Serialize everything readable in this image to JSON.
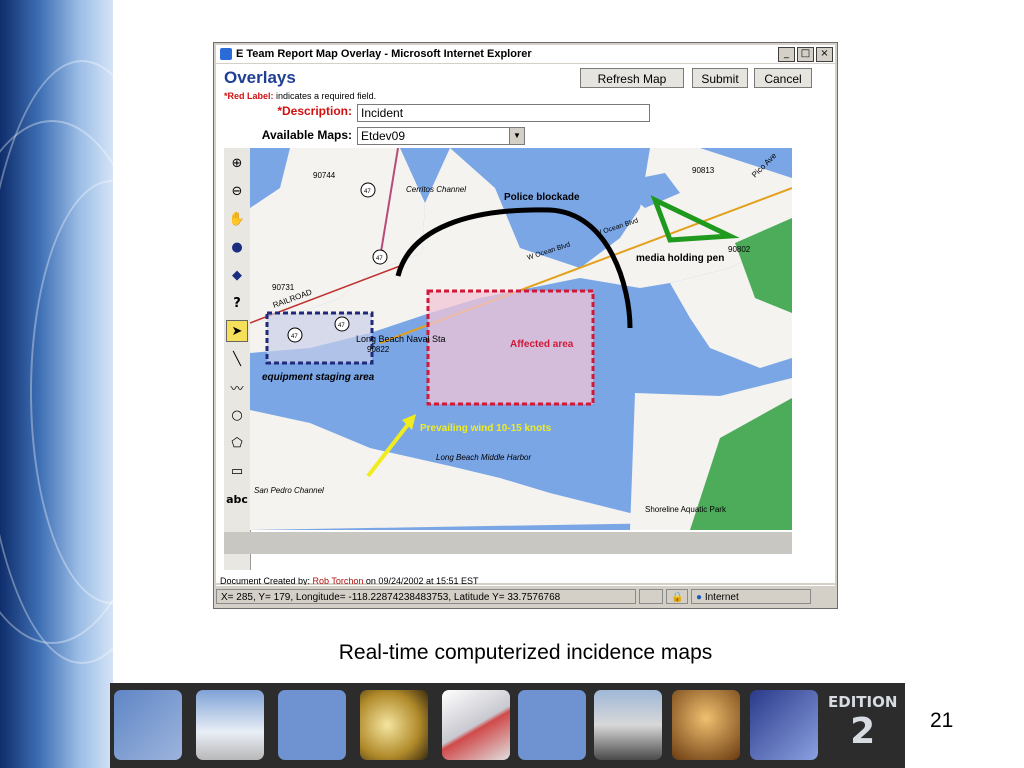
{
  "window": {
    "title": "E Team Report Map Overlay - Microsoft Internet Explorer",
    "minimize": "_",
    "maximize": "□",
    "close": "×"
  },
  "form": {
    "heading": "Overlays",
    "required_prefix": "*Red Label:",
    "required_text": " indicates a required field.",
    "description_label": "*Description:",
    "description_value": "Incident",
    "maps_label": "Available Maps:",
    "maps_selected": "Etdev09",
    "refresh_label": "Refresh Map",
    "submit_label": "Submit",
    "cancel_label": "Cancel"
  },
  "tools": {
    "zoom_in": "⊕",
    "zoom_out": "⊖",
    "pan": "✋",
    "globe": "●",
    "map": "◆",
    "help": "?",
    "select": "➤",
    "line": "╲",
    "polyline": "〰",
    "circle": "○",
    "polygon": "⬠",
    "rect": "▭",
    "text": "abc",
    "delete": "✕"
  },
  "map": {
    "labels": {
      "zone_90744": "90744",
      "zone_90813": "90813",
      "zone_90802": "90802",
      "zone_90731": "90731",
      "zone_90822": "90822",
      "cerritos": "Cerritos Channel",
      "police": "Police blockade",
      "ocean1": "W Ocean Blvd",
      "ocean2": "W Ocean Blvd",
      "media": "media holding pen",
      "railroad": "RAILROAD",
      "naval": "Long Beach Naval Sta",
      "affected": "Affected area",
      "equipment": "equipment staging area",
      "wind": "Prevailing wind 10-15 knots",
      "middle_harbor": "Long Beach Middle Harbor",
      "san_pedro": "San Pedro Channel",
      "shoreline": "Shoreline Aquatic Park",
      "pico": "Pico Ave",
      "route": "47"
    }
  },
  "document_line": {
    "prefix": "Document Created by: ",
    "author": "Rob Torchon",
    "suffix": " on 09/24/2002 at 15:51 EST"
  },
  "status": {
    "coords": "X= 285,  Y= 179,  Longitude= -118.22874238483753,   Latitude Y= 33.7576768",
    "zone": "Internet"
  },
  "caption": "Real-time computerized incidence maps",
  "edition": {
    "word": "EDITION",
    "number": "2"
  },
  "page_number": "21"
}
